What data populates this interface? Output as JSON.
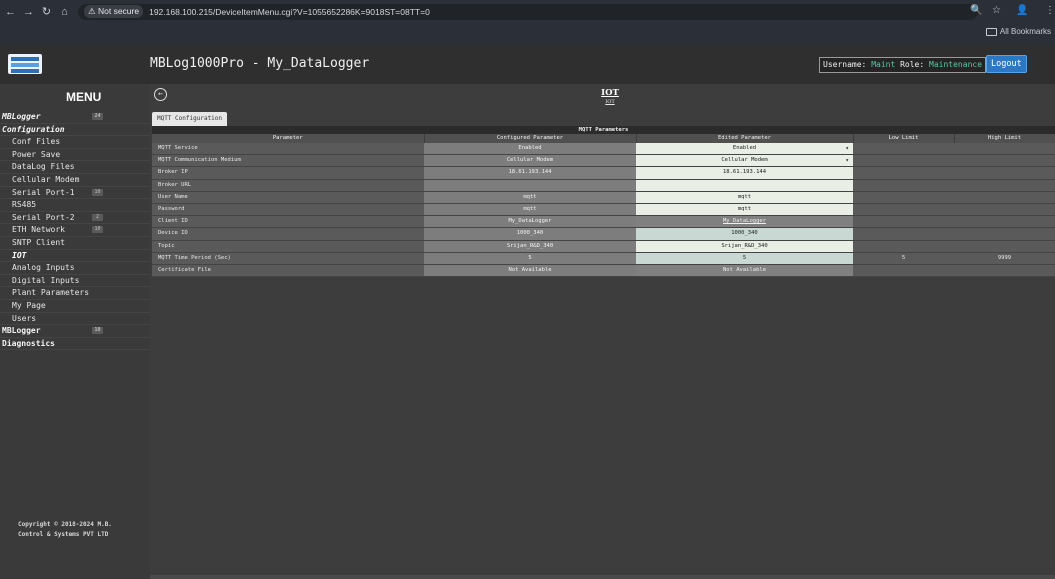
{
  "browser": {
    "url": "192.168.100.215/DeviceItemMenu.cgi?V=1055652286K=9018ST=08TT=0",
    "secure_label": "Not secure",
    "bookmarks_label": "All Bookmarks"
  },
  "header": {
    "app_title": "MBLog1000Pro - My_DataLogger",
    "username_label": "Username:",
    "username": "Maint",
    "role_label": "Role:",
    "role": "Maintenance",
    "logout_label": "Logout"
  },
  "sidebar": {
    "title": "MENU",
    "items": [
      {
        "label": "MBLogger",
        "level": 0,
        "badge": "14"
      },
      {
        "label": "Configuration",
        "level": 0
      },
      {
        "label": "Conf Files",
        "level": 1
      },
      {
        "label": "Power Save",
        "level": 1
      },
      {
        "label": "DataLog Files",
        "level": 1
      },
      {
        "label": "Cellular Modem",
        "level": 1
      },
      {
        "label": "Serial Port-1",
        "level": 1,
        "badge": "10"
      },
      {
        "label": "RS485",
        "level": 1
      },
      {
        "label": "Serial Port-2",
        "level": 1,
        "badge": "2"
      },
      {
        "label": "ETH Network",
        "level": 1,
        "badge": "10"
      },
      {
        "label": "SNTP Client",
        "level": 1
      },
      {
        "label": "IOT",
        "level": 1,
        "active": true
      },
      {
        "label": "Analog Inputs",
        "level": 1
      },
      {
        "label": "Digital Inputs",
        "level": 1
      },
      {
        "label": "Plant Parameters",
        "level": 1
      },
      {
        "label": "My Page",
        "level": 1
      },
      {
        "label": "Users",
        "level": 1
      },
      {
        "label": "MBLogger",
        "level": 0,
        "badge": "10",
        "plain": true
      },
      {
        "label": "Diagnostics",
        "level": 0,
        "plain": true
      }
    ],
    "copyright_line1": "Copyright © 2018-2024 M.B.",
    "copyright_line2": "Control & Systems PVT LTD"
  },
  "main": {
    "page_title": "IOT",
    "page_subtitle": "IOT",
    "tab_label": "MQTT Configuration",
    "table_caption": "MQTT Parameters",
    "columns": [
      "Parameter",
      "Configured Parameter",
      "Edited Parameter",
      "Low Limit",
      "High Limit"
    ],
    "rows": [
      {
        "param": "MQTT Service",
        "configured": "Enabled",
        "edited": "Enabled",
        "edited_type": "select",
        "low": "",
        "high": ""
      },
      {
        "param": "MQTT Communication Medium",
        "configured": "Cellular Modem",
        "edited": "Cellular Modem",
        "edited_type": "select",
        "low": "",
        "high": ""
      },
      {
        "param": "Broker IP",
        "configured": "18.61.193.144",
        "edited": "18.61.193.144",
        "edited_type": "text",
        "low": "",
        "high": ""
      },
      {
        "param": "Broker URL",
        "configured": "",
        "edited": "",
        "edited_type": "text",
        "low": "",
        "high": ""
      },
      {
        "param": "User Name",
        "configured": "mqtt",
        "edited": "mqtt",
        "edited_type": "text",
        "low": "",
        "high": ""
      },
      {
        "param": "Password",
        "configured": "mqtt",
        "edited": "mqtt",
        "edited_type": "text",
        "low": "",
        "high": ""
      },
      {
        "param": "Client ID",
        "configured": "My_DataLogger",
        "edited": "My_DataLogger",
        "edited_type": "readonly",
        "low": "",
        "high": ""
      },
      {
        "param": "Device ID",
        "configured": "1000_340",
        "edited": "1000_340",
        "edited_type": "text-alt",
        "low": "",
        "high": ""
      },
      {
        "param": "Topic",
        "configured": "Srijan_R&D_340",
        "edited": "Srijan_R&D_340",
        "edited_type": "text",
        "low": "",
        "high": ""
      },
      {
        "param": "MQTT Time Period (Sec)",
        "configured": "5",
        "edited": "5",
        "edited_type": "text-alt",
        "low": "5",
        "high": "9999"
      },
      {
        "param": "Certificate File",
        "configured": "Not Available",
        "edited": "Not Available",
        "edited_type": "readonly",
        "low": "",
        "high": ""
      }
    ]
  }
}
